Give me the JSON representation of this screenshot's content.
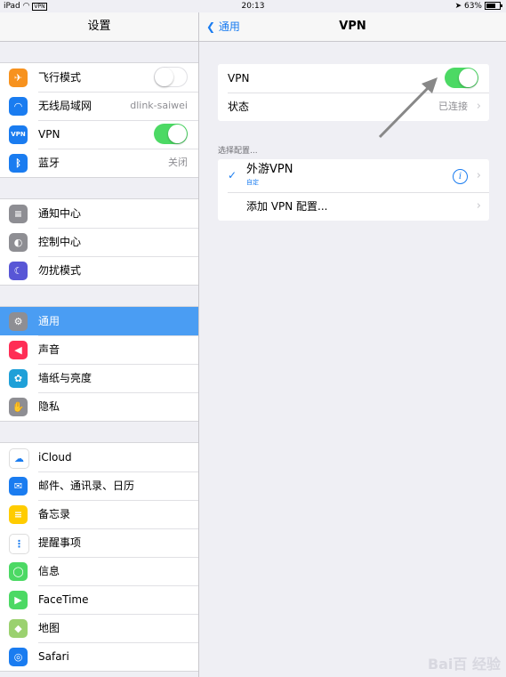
{
  "status": {
    "device": "iPad",
    "vpn_badge": "VPN",
    "time": "20:13",
    "battery": "63%"
  },
  "left": {
    "title": "设置",
    "groups": [
      [
        {
          "label": "飞行模式",
          "icon": "airplane-icon",
          "color": "#f7921e",
          "control": "toggle-off"
        },
        {
          "label": "无线局域网",
          "icon": "wifi-icon",
          "color": "#1a7cf0",
          "value": "dlink-saiwei"
        },
        {
          "label": "VPN",
          "icon": "vpn-icon",
          "color": "#1a7cf0",
          "control": "toggle-on"
        },
        {
          "label": "蓝牙",
          "icon": "bluetooth-icon",
          "color": "#1a7cf0",
          "value": "关闭"
        }
      ],
      [
        {
          "label": "通知中心",
          "icon": "notification-center-icon",
          "color": "#8e8e93"
        },
        {
          "label": "控制中心",
          "icon": "control-center-icon",
          "color": "#8e8e93"
        },
        {
          "label": "勿扰模式",
          "icon": "moon-icon",
          "color": "#5856d6"
        }
      ],
      [
        {
          "label": "通用",
          "icon": "gear-icon",
          "color": "#8e8e93",
          "selected": true
        },
        {
          "label": "声音",
          "icon": "speaker-icon",
          "color": "#ff2d55"
        },
        {
          "label": "墙纸与亮度",
          "icon": "flower-icon",
          "color": "#1fa0d8"
        },
        {
          "label": "隐私",
          "icon": "hand-icon",
          "color": "#8e8e93"
        }
      ],
      [
        {
          "label": "iCloud",
          "icon": "cloud-icon",
          "color": "#ffffff"
        },
        {
          "label": "邮件、通讯录、日历",
          "icon": "mail-icon",
          "color": "#1a7cf0"
        },
        {
          "label": "备忘录",
          "icon": "notes-icon",
          "color": "#ffcc00"
        },
        {
          "label": "提醒事项",
          "icon": "reminders-icon",
          "color": "#ffffff"
        },
        {
          "label": "信息",
          "icon": "messages-icon",
          "color": "#4cd964"
        },
        {
          "label": "FaceTime",
          "icon": "facetime-icon",
          "color": "#4cd964"
        },
        {
          "label": "地图",
          "icon": "maps-icon",
          "color": "#9bd16f"
        },
        {
          "label": "Safari",
          "icon": "safari-icon",
          "color": "#1a7cf0"
        }
      ]
    ]
  },
  "right": {
    "back": "通用",
    "title": "VPN",
    "vpn_label": "VPN",
    "status_label": "状态",
    "status_value": "已连接",
    "section_header": "选择配置...",
    "config_name": "外游VPN",
    "config_sub": "自定",
    "add_config": "添加 VPN 配置..."
  },
  "watermark": "Bai百 经验"
}
